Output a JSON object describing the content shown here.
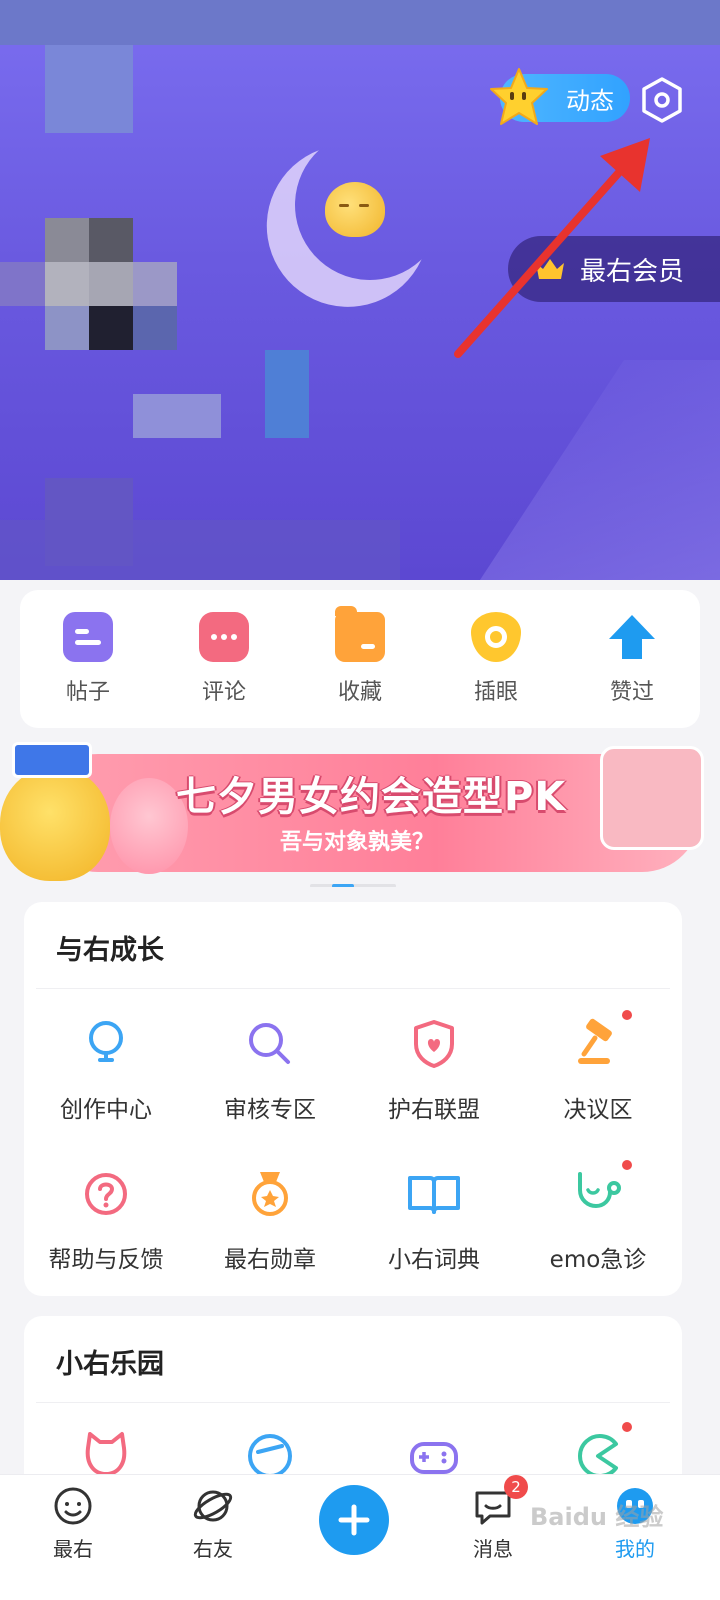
{
  "header": {
    "dynamic_label": "动态",
    "member_label": "最右会员"
  },
  "quick_actions": [
    {
      "label": "帖子",
      "icon": "post-icon",
      "color": "#8b73ef"
    },
    {
      "label": "评论",
      "icon": "comment-icon",
      "color": "#f36a80"
    },
    {
      "label": "收藏",
      "icon": "folder-icon",
      "color": "#ffa33a"
    },
    {
      "label": "插眼",
      "icon": "eye-icon",
      "color": "#ffc72e"
    },
    {
      "label": "赞过",
      "icon": "thumb-up-icon",
      "color": "#1e9bf0"
    }
  ],
  "banner": {
    "title": "七夕男女约会造型PK",
    "subtitle": "吾与对象孰美？"
  },
  "growth": {
    "title": "与右成长",
    "items": [
      {
        "label": "创作中心",
        "icon": "lightbulb-icon",
        "color": "#3ca5f4",
        "dot": false
      },
      {
        "label": "审核专区",
        "icon": "magnifier-icon",
        "color": "#8b73ef",
        "dot": false
      },
      {
        "label": "护右联盟",
        "icon": "shield-heart-icon",
        "color": "#f36a80",
        "dot": false
      },
      {
        "label": "决议区",
        "icon": "gavel-icon",
        "color": "#ffa33a",
        "dot": true
      },
      {
        "label": "帮助与反馈",
        "icon": "question-icon",
        "color": "#f36a80",
        "dot": false
      },
      {
        "label": "最右勋章",
        "icon": "medal-icon",
        "color": "#ffa33a",
        "dot": false
      },
      {
        "label": "小右词典",
        "icon": "book-icon",
        "color": "#3ca5f4",
        "dot": false
      },
      {
        "label": "emo急诊",
        "icon": "stethoscope-icon",
        "color": "#3cc8a0",
        "dot": true
      }
    ]
  },
  "park": {
    "title": "小右乐园",
    "items": [
      {
        "icon": "cat-icon",
        "color": "#f36a80",
        "dot": false
      },
      {
        "icon": "smile-face-icon",
        "color": "#3ca5f4",
        "dot": false
      },
      {
        "icon": "gamepad-icon",
        "color": "#8b73ef",
        "dot": false
      },
      {
        "icon": "pacman-icon",
        "color": "#3cc8a0",
        "dot": true
      }
    ]
  },
  "bottom_nav": {
    "items": [
      {
        "label": "最右",
        "icon": "home-face-icon"
      },
      {
        "label": "右友",
        "icon": "planet-icon"
      },
      {
        "label": "消息",
        "icon": "message-icon",
        "badge": "2"
      },
      {
        "label": "我的",
        "icon": "profile-icon"
      }
    ]
  },
  "watermark": "Baidu 经验"
}
